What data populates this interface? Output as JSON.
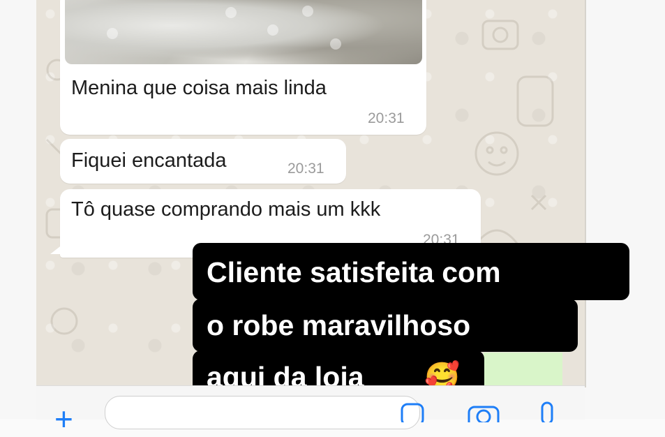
{
  "chat": {
    "messages": [
      {
        "text": "Menina que coisa mais linda",
        "time": "20:31",
        "has_image": true
      },
      {
        "text": "Fiquei encantada",
        "time": "20:31"
      },
      {
        "text": "Tô quase comprando mais um kkk",
        "time": "20:31"
      }
    ]
  },
  "caption": {
    "line1": "Cliente satisfeita com",
    "line2": "o robe maravilhoso",
    "line3": "aqui da loja",
    "emoji": "🥰"
  },
  "input_bar": {
    "icons": [
      "plus-icon",
      "sticker-icon",
      "camera-icon",
      "microphone-icon"
    ]
  },
  "colors": {
    "accent": "#1e7ef7",
    "chat_background": "#e8e3da",
    "bubble": "#ffffff",
    "caption_background": "#000000",
    "outgoing_bubble": "#d9f5c9"
  }
}
